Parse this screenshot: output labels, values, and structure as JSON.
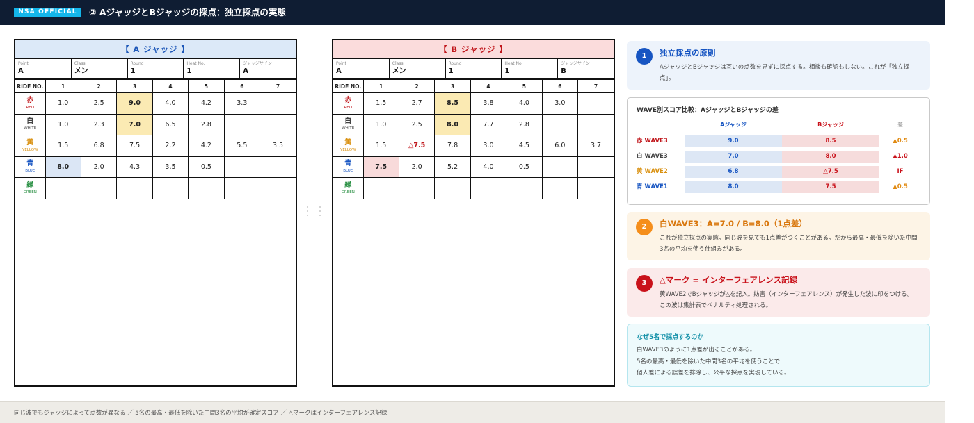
{
  "header": {
    "badge": "NSA OFFICIAL",
    "title": "② AジャッジとBジャッジの採点：独立採点の実態"
  },
  "sheets": [
    {
      "title": "【 A ジャッジ 】",
      "info": [
        {
          "label": "Point",
          "value": "A"
        },
        {
          "label": "Class",
          "value": "メン"
        },
        {
          "label": "Round",
          "value": "1"
        },
        {
          "label": "Heat No.",
          "value": "1"
        },
        {
          "label": "ジャッジサイン",
          "value": "A"
        }
      ],
      "header_ride": "RIDE NO.",
      "columns": [
        "1",
        "2",
        "3",
        "4",
        "5",
        "6",
        "7"
      ],
      "riders": [
        {
          "kanji": "赤",
          "en": "RED",
          "color": "#c0161b",
          "scores": [
            "1.0",
            "2.5",
            "9.0",
            "4.0",
            "4.2",
            "3.3",
            ""
          ],
          "highlight": {
            "2": "yellow"
          }
        },
        {
          "kanji": "白",
          "en": "WHITE",
          "color": "#444444",
          "scores": [
            "1.0",
            "2.3",
            "7.0",
            "6.5",
            "2.8",
            "",
            ""
          ],
          "highlight": {
            "2": "yellow"
          }
        },
        {
          "kanji": "黄",
          "en": "YELLOW",
          "color": "#d9900f",
          "scores": [
            "1.5",
            "6.8",
            "7.5",
            "2.2",
            "4.2",
            "5.5",
            "3.5"
          ],
          "highlight": {}
        },
        {
          "kanji": "青",
          "en": "BLUE",
          "color": "#1755c2",
          "scores": [
            "8.0",
            "2.0",
            "4.3",
            "3.5",
            "0.5",
            "",
            ""
          ],
          "highlight": {
            "0": "blue"
          }
        },
        {
          "kanji": "緑",
          "en": "GREEN",
          "color": "#1f8a3a",
          "scores": [
            "",
            "",
            "",
            "",
            "",
            "",
            ""
          ],
          "highlight": {}
        }
      ]
    },
    {
      "title": "【 B ジャッジ 】",
      "info": [
        {
          "label": "Point",
          "value": "A"
        },
        {
          "label": "Class",
          "value": "メン"
        },
        {
          "label": "Round",
          "value": "1"
        },
        {
          "label": "Heat No.",
          "value": "1"
        },
        {
          "label": "ジャッジサイン",
          "value": "B"
        }
      ],
      "header_ride": "RIDE NO.",
      "columns": [
        "1",
        "2",
        "3",
        "4",
        "5",
        "6",
        "7"
      ],
      "riders": [
        {
          "kanji": "赤",
          "en": "RED",
          "color": "#c0161b",
          "scores": [
            "1.5",
            "2.7",
            "8.5",
            "3.8",
            "4.0",
            "3.0",
            ""
          ],
          "highlight": {
            "2": "yellow"
          }
        },
        {
          "kanji": "白",
          "en": "WHITE",
          "color": "#444444",
          "scores": [
            "1.0",
            "2.5",
            "8.0",
            "7.7",
            "2.8",
            "",
            ""
          ],
          "highlight": {
            "2": "yellow"
          }
        },
        {
          "kanji": "黄",
          "en": "YELLOW",
          "color": "#d9900f",
          "scores": [
            "1.5",
            "△7.5",
            "7.8",
            "3.0",
            "4.5",
            "6.0",
            "3.7"
          ],
          "highlight": {
            "1": "mark"
          }
        },
        {
          "kanji": "青",
          "en": "BLUE",
          "color": "#1755c2",
          "scores": [
            "7.5",
            "2.0",
            "5.2",
            "4.0",
            "0.5",
            "",
            ""
          ],
          "highlight": {
            "0": "pink"
          }
        },
        {
          "kanji": "緑",
          "en": "GREEN",
          "color": "#1f8a3a",
          "scores": [
            "",
            "",
            "",
            "",
            "",
            "",
            ""
          ],
          "highlight": {}
        }
      ]
    }
  ],
  "card1": {
    "number": "1",
    "title": "独立採点の原則",
    "body": "AジャッジとBジャッジは互いの点数を見ずに採点する。相談も確認もしない。これが「独立採点」。"
  },
  "compare": {
    "title": "WAVE別スコア比較：AジャッジとBジャッジの差",
    "head_a": "Aジャッジ",
    "head_b": "Bジャッジ",
    "head_diff": "差",
    "rows": [
      {
        "label": "赤 WAVE3",
        "a": "9.0",
        "b": "8.5",
        "diff": "▲0.5",
        "label_color": "#c0161b",
        "diff_color": "#e08a12"
      },
      {
        "label": "白 WAVE3",
        "a": "7.0",
        "b": "8.0",
        "diff": "▲1.0",
        "label_color": "#444444",
        "diff_color": "#c9121b"
      },
      {
        "label": "黄 WAVE2",
        "a": "6.8",
        "b": "△7.5",
        "diff": "IF",
        "label_color": "#d9900f",
        "diff_color": "#c9121b"
      },
      {
        "label": "青 WAVE1",
        "a": "8.0",
        "b": "7.5",
        "diff": "▲0.5",
        "label_color": "#1755c2",
        "diff_color": "#e08a12"
      }
    ]
  },
  "card2": {
    "number": "2",
    "title": "白WAVE3：A=7.0 / B=8.0（1点差）",
    "body": "これが独立採点の実態。同じ波を見ても1点差がつくことがある。だから最高・最低を除いた中間3名の平均を使う仕組みがある。"
  },
  "card3": {
    "number": "3",
    "title": "△マーク = インターフェアレンス記録",
    "body": "黄WAVE2でBジャッジが△を記入。妨害（インターフェアレンス）が発生した波に印をつける。この波は集計表でペナルティ処理される。"
  },
  "card4": {
    "title": "なぜ5名で採点するのか",
    "lines": [
      "白WAVE3のように1点差が出ることがある。",
      "5名の最高・最低を除いた中間3名の平均を使うことで",
      "個人差による誤差を排除し、公平な採点を実現している。"
    ]
  },
  "footer": {
    "text": "同じ波でもジャッジによって点数が異なる ／ 5名の最高・最低を除いた中間3名の平均が確定スコア ／ △マークはインターフェアレンス記録"
  }
}
